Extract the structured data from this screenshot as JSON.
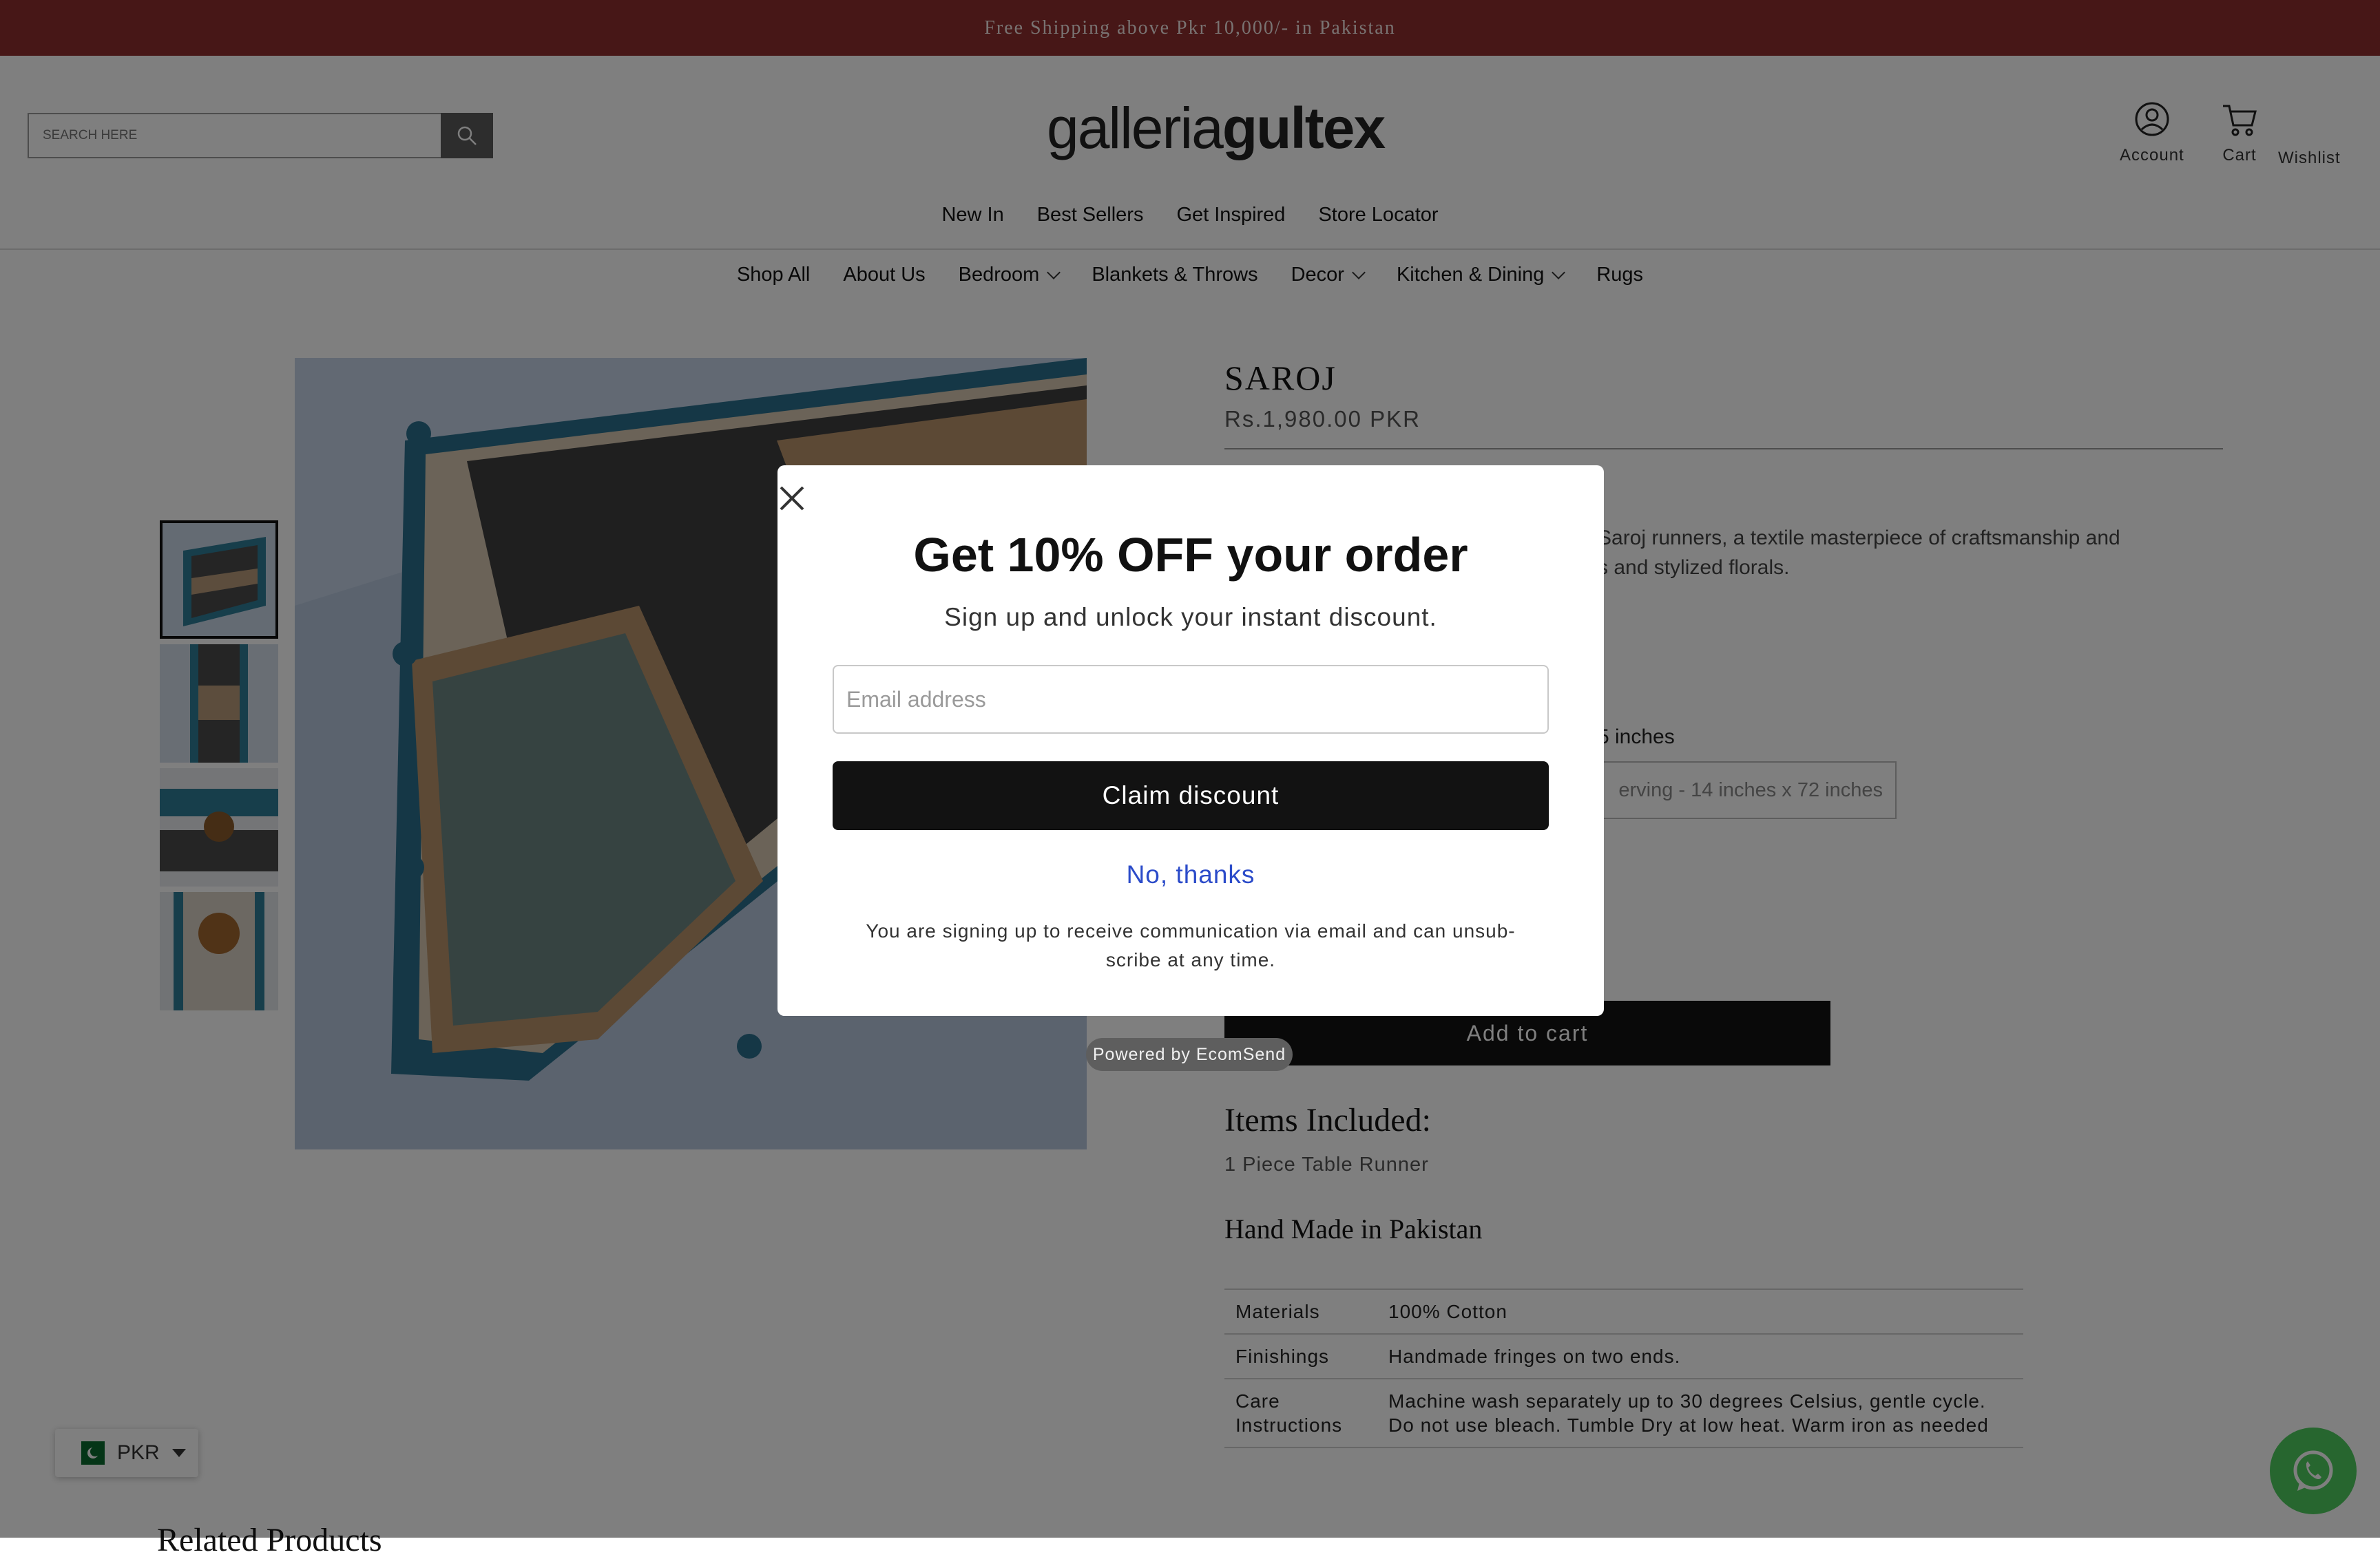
{
  "announcement": "Free Shipping above Pkr 10,000/- in Pakistan",
  "header": {
    "search_placeholder": "SEARCH HERE",
    "logo_part1": "galleria",
    "logo_part2": "gultex",
    "account_label": "Account",
    "cart_label": "Cart",
    "wishlist_label": "Wishlist"
  },
  "nav_primary": [
    "New In",
    "Best Sellers",
    "Get Inspired",
    "Store Locator"
  ],
  "nav_secondary": [
    "Shop All",
    "About Us",
    "Bedroom",
    "Blankets & Throws",
    "Decor",
    "Kitchen & Dining",
    "Rugs"
  ],
  "product": {
    "title": "SAROJ",
    "price": "Rs.1,980.00 PKR",
    "description_visible": "Saroj runners, a textile masterpiece of craftsmanship and",
    "description_visible_2": "s and stylized florals.",
    "size_label_visible": "5 inches",
    "size_option_visible": "erving - 14 inches x 72 inches",
    "add_to_cart": "Add to cart",
    "items_heading": "Items Included:",
    "items_value": "1 Piece Table Runner",
    "made_in": "Hand Made in Pakistan",
    "specs": [
      {
        "key": "Materials",
        "value": "100% Cotton"
      },
      {
        "key": "Finishings",
        "value": "Handmade fringes on two ends."
      },
      {
        "key": "Care Instructions",
        "value": "Machine wash separately up to 30 degrees Celsius, gentle cycle. Do not use bleach. Tumble Dry at low heat. Warm iron as needed"
      }
    ]
  },
  "related_heading": "Related Products",
  "currency": {
    "code": "PKR"
  },
  "popup": {
    "title": "Get 10% OFF your order",
    "subtitle": "Sign up and unlock your instant discount.",
    "email_placeholder": "Email address",
    "claim_button": "Claim discount",
    "decline": "No, thanks",
    "legal": "You are signing up to receive communication via email and can unsub-scribe at any time.",
    "powered_by": "Powered by EcomSend"
  },
  "colors": {
    "announcement_bg": "#8e2f2e",
    "button_bg": "#121212",
    "link_blue": "#2b4bc9",
    "whatsapp_green": "#4fcd5f",
    "teal": "#1f6f8f"
  }
}
